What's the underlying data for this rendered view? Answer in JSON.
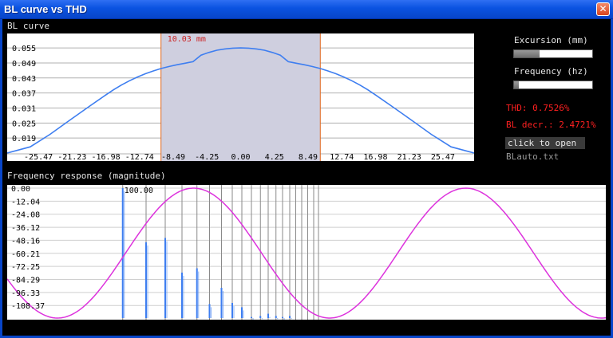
{
  "window": {
    "title": "BL curve vs THD",
    "close_glyph": "✕"
  },
  "bl_section": {
    "label": "BL curve",
    "selection_label": "10.03 mm"
  },
  "freq_section": {
    "label": "Frequency response (magnitude)",
    "marker_label": "100.00"
  },
  "controls": {
    "excursion_label": "Excursion (mm)",
    "excursion_level": 0.33,
    "frequency_label": "Frequency (hz)",
    "frequency_level": 0.06,
    "thd_text": "THD: 0.7526%",
    "bl_decr_text": "BL decr.: 2.4721%",
    "open_button_label": "click to open",
    "file_name": "BLauto.txt"
  },
  "colors": {
    "curve": "#3e7ef0",
    "sine": "#dd33dd",
    "selection": "#cfcfdf",
    "selection_edge": "#e06820",
    "selection_text": "#cc2222",
    "bars": "#3e7ef0",
    "grid": "#b0b0b0"
  },
  "chart_data": [
    {
      "type": "line",
      "name": "bl-curve",
      "x_ticks": [
        "-25.47",
        "-21.23",
        "-16.98",
        "-12.74",
        "-8.49",
        "-4.25",
        "0.00",
        "4.25",
        "8.49",
        "12.74",
        "16.98",
        "21.23",
        "25.47"
      ],
      "y_ticks": [
        "0.055",
        "0.049",
        "0.043",
        "0.037",
        "0.031",
        "0.025",
        "0.019"
      ],
      "xlim": [
        -29.4,
        29.4
      ],
      "ylim": [
        0.013,
        0.0595
      ],
      "selection": [
        -10.03,
        10.03
      ],
      "points": [
        [
          -29.4,
          0.013
        ],
        [
          -26.5,
          0.0155
        ],
        [
          -24.0,
          0.0205
        ],
        [
          -21.5,
          0.0262
        ],
        [
          -19.0,
          0.0318
        ],
        [
          -17.0,
          0.0362
        ],
        [
          -16.0,
          0.0383
        ],
        [
          -15.0,
          0.0402
        ],
        [
          -14.0,
          0.0419
        ],
        [
          -13.0,
          0.0434
        ],
        [
          -12.0,
          0.0447
        ],
        [
          -11.0,
          0.0458
        ],
        [
          -10.0,
          0.0468
        ],
        [
          -9.0,
          0.0476
        ],
        [
          -8.0,
          0.0483
        ],
        [
          -7.0,
          0.0489
        ],
        [
          -6.5,
          0.0492
        ],
        [
          -6.0,
          0.0495
        ],
        [
          -5.0,
          0.0521
        ],
        [
          -4.0,
          0.0532
        ],
        [
          -3.0,
          0.0541
        ],
        [
          -2.0,
          0.0546
        ],
        [
          -1.0,
          0.0549
        ],
        [
          0.0,
          0.055
        ],
        [
          1.0,
          0.0549
        ],
        [
          2.0,
          0.0546
        ],
        [
          3.0,
          0.0541
        ],
        [
          4.0,
          0.0532
        ],
        [
          5.0,
          0.0521
        ],
        [
          6.0,
          0.0495
        ],
        [
          6.5,
          0.0492
        ],
        [
          7.0,
          0.0489
        ],
        [
          8.0,
          0.0483
        ],
        [
          9.0,
          0.0476
        ],
        [
          10.0,
          0.0468
        ],
        [
          11.0,
          0.0458
        ],
        [
          12.0,
          0.0447
        ],
        [
          13.0,
          0.0434
        ],
        [
          14.0,
          0.0419
        ],
        [
          15.0,
          0.0402
        ],
        [
          16.0,
          0.0383
        ],
        [
          17.0,
          0.0362
        ],
        [
          19.0,
          0.0318
        ],
        [
          21.5,
          0.0262
        ],
        [
          24.0,
          0.0205
        ],
        [
          26.5,
          0.0155
        ],
        [
          29.4,
          0.013
        ]
      ]
    },
    {
      "type": "bar",
      "name": "frequency-response",
      "y_ticks": [
        "0.00",
        "-12.04",
        "-24.08",
        "-36.12",
        "-48.16",
        "-60.21",
        "-72.25",
        "-84.29",
        "-96.33",
        "-108.37"
      ],
      "ylim": [
        -120,
        0
      ],
      "harmonic_fractions": [
        0.193,
        0.232,
        0.264,
        0.292,
        0.317,
        0.338,
        0.358,
        0.376,
        0.392,
        0.408,
        0.423,
        0.436,
        0.449,
        0.46,
        0.472,
        0.482,
        0.492,
        0.502,
        0.512,
        0.52
      ],
      "bar_values": [
        0,
        -50,
        -46,
        -78,
        -74,
        -107,
        -92,
        -106,
        -110,
        -119,
        -118,
        -116,
        -118,
        -119,
        -118
      ],
      "sine": {
        "cycles": 2.2,
        "phase": 3.55,
        "amplitude": 0.5,
        "midline": -60
      }
    }
  ]
}
